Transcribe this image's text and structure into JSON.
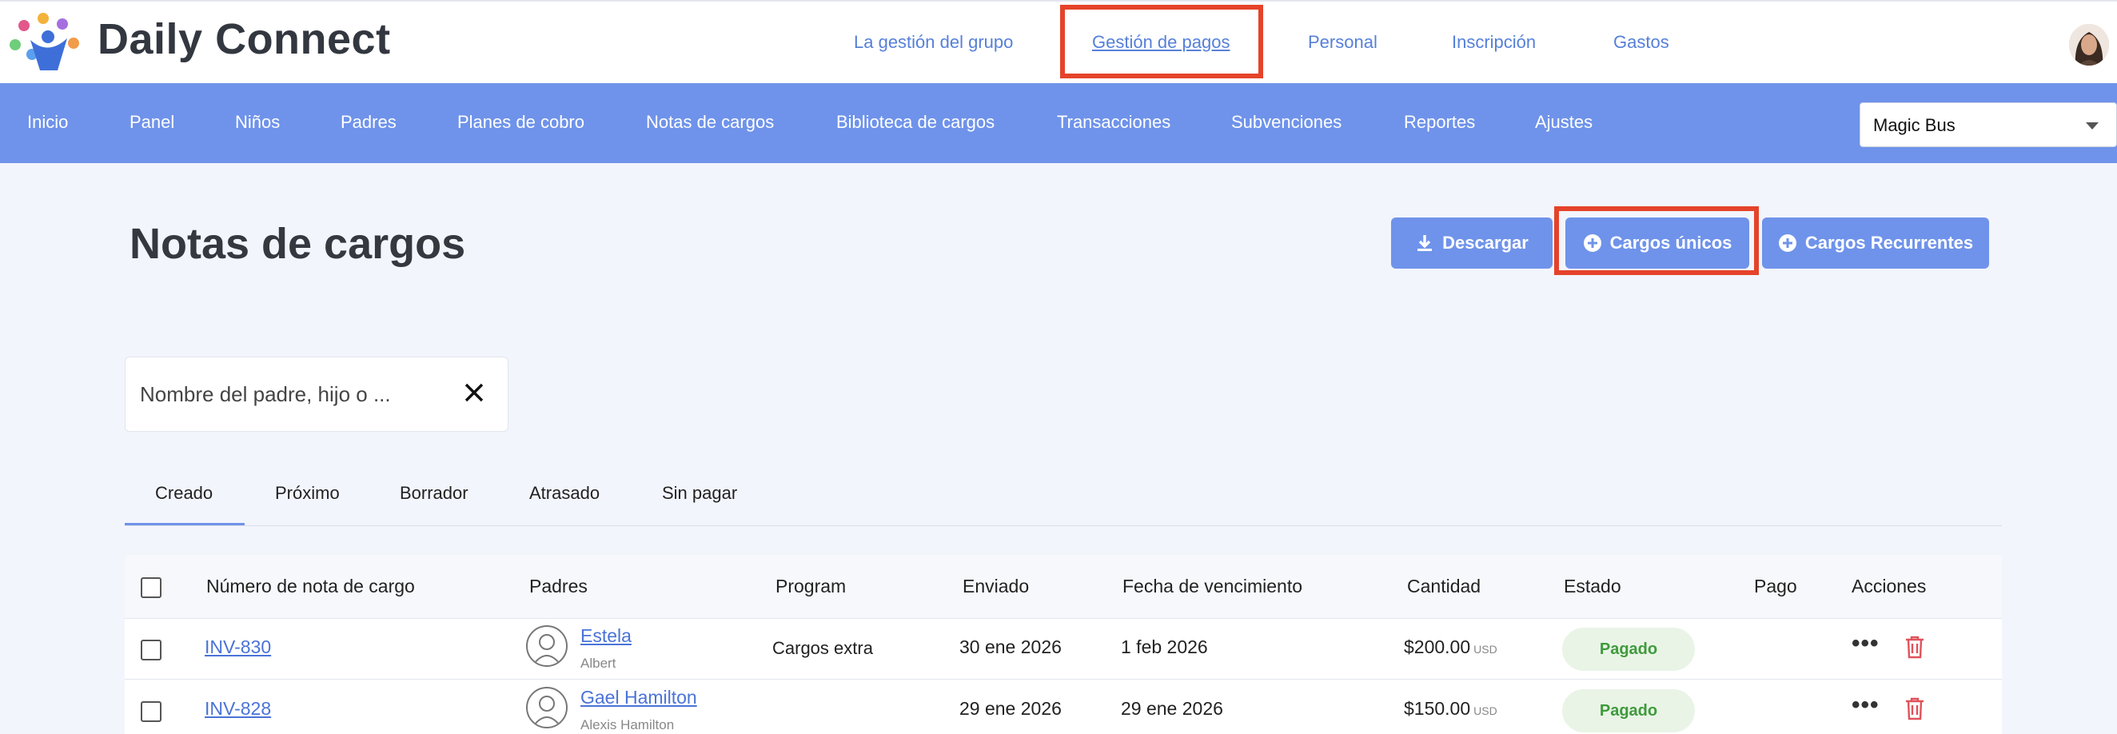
{
  "app": {
    "brand": "Daily Connect"
  },
  "top_nav": [
    {
      "label": "La gestión del grupo"
    },
    {
      "label": "Gestión de pagos"
    },
    {
      "label": "Personal"
    },
    {
      "label": "Inscripción"
    },
    {
      "label": "Gastos"
    }
  ],
  "main_nav": [
    {
      "label": "Inicio"
    },
    {
      "label": "Panel"
    },
    {
      "label": "Niños"
    },
    {
      "label": "Padres"
    },
    {
      "label": "Planes de cobro"
    },
    {
      "label": "Notas de cargos"
    },
    {
      "label": "Biblioteca de cargos"
    },
    {
      "label": "Transacciones"
    },
    {
      "label": "Subvenciones"
    },
    {
      "label": "Reportes"
    },
    {
      "label": "Ajustes"
    }
  ],
  "location_select": {
    "value": "Magic Bus"
  },
  "page": {
    "title": "Notas de cargos"
  },
  "actions": {
    "download": "Descargar",
    "one_time": "Cargos únicos",
    "recurring": "Cargos Recurrentes"
  },
  "search": {
    "placeholder": "Nombre del padre, hijo o ..."
  },
  "tabs": [
    "Creado",
    "Próximo",
    "Borrador",
    "Atrasado",
    "Sin pagar"
  ],
  "table": {
    "columns": [
      "Número de nota de cargo",
      "Padres",
      "Program",
      "Enviado",
      "Fecha de vencimiento",
      "Cantidad",
      "Estado",
      "Pago",
      "Acciones"
    ],
    "rows": [
      {
        "invoice": "INV-830",
        "parent": "Estela",
        "child": "Albert",
        "program": "Cargos extra",
        "sent": "30 ene 2026",
        "due": "1 feb 2026",
        "amount": "$200.00",
        "currency": "USD",
        "status": "Pagado",
        "payment": ""
      },
      {
        "invoice": "INV-828",
        "parent": "Gael Hamilton",
        "child": "Alexis Hamilton",
        "program": "",
        "sent": "29 ene 2026",
        "due": "29 ene 2026",
        "amount": "$150.00",
        "currency": "USD",
        "status": "Pagado",
        "payment": ""
      }
    ]
  },
  "colors": {
    "accent": "#6f93ea",
    "highlight": "#e5432a",
    "paid_bg": "#e9f4e6",
    "paid_text": "#3f9a3c",
    "danger": "#e0525b"
  }
}
